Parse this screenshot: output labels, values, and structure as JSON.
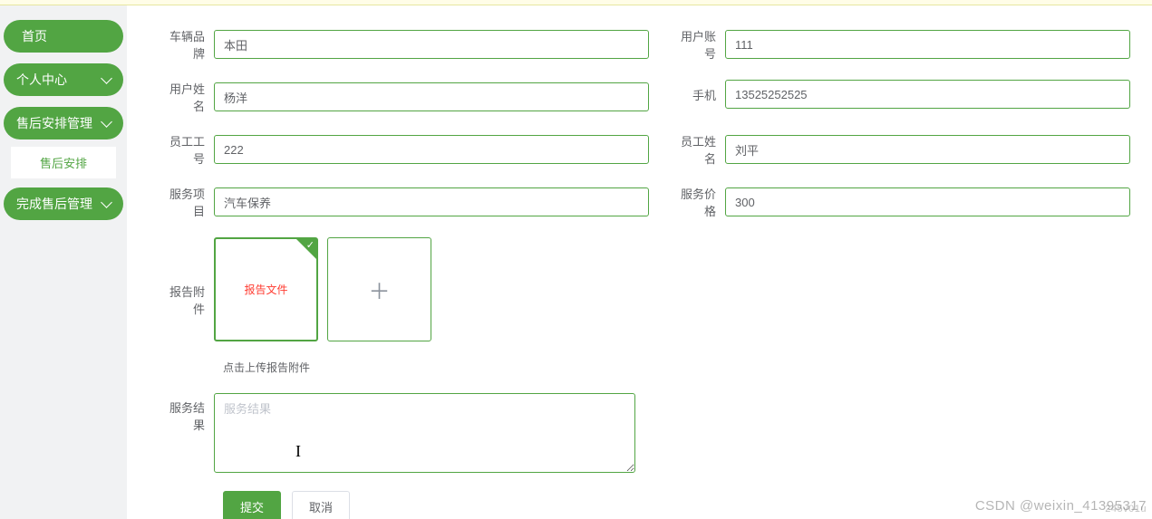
{
  "sidebar": {
    "home": "首页",
    "personal": "个人中心",
    "after_mgmt": "售后安排管理",
    "after_sub": "售后安排",
    "complete_mgmt": "完成售后管理"
  },
  "form": {
    "brand": {
      "label": "车辆品牌",
      "value": "本田"
    },
    "user_account": {
      "label": "用户账号",
      "value": "111"
    },
    "user_name": {
      "label": "用户姓名",
      "value": "杨洋"
    },
    "phone": {
      "label": "手机",
      "value": "13525252525"
    },
    "emp_id": {
      "label": "员工工号",
      "value": "222"
    },
    "emp_name": {
      "label": "员工姓名",
      "value": "刘平"
    },
    "service_item": {
      "label": "服务项目",
      "value": "汽车保养"
    },
    "service_price": {
      "label": "服务价格",
      "value": "300"
    },
    "attachment": {
      "label": "报告附件",
      "file_label": "报告文件"
    },
    "upload_hint": "点击上传报告附件",
    "result": {
      "label": "服务结果",
      "placeholder": "服务结果"
    }
  },
  "buttons": {
    "submit": "提交",
    "cancel": "取消"
  },
  "watermark": "CSDN @weixin_41395317",
  "watermark_sub": "245v01u"
}
